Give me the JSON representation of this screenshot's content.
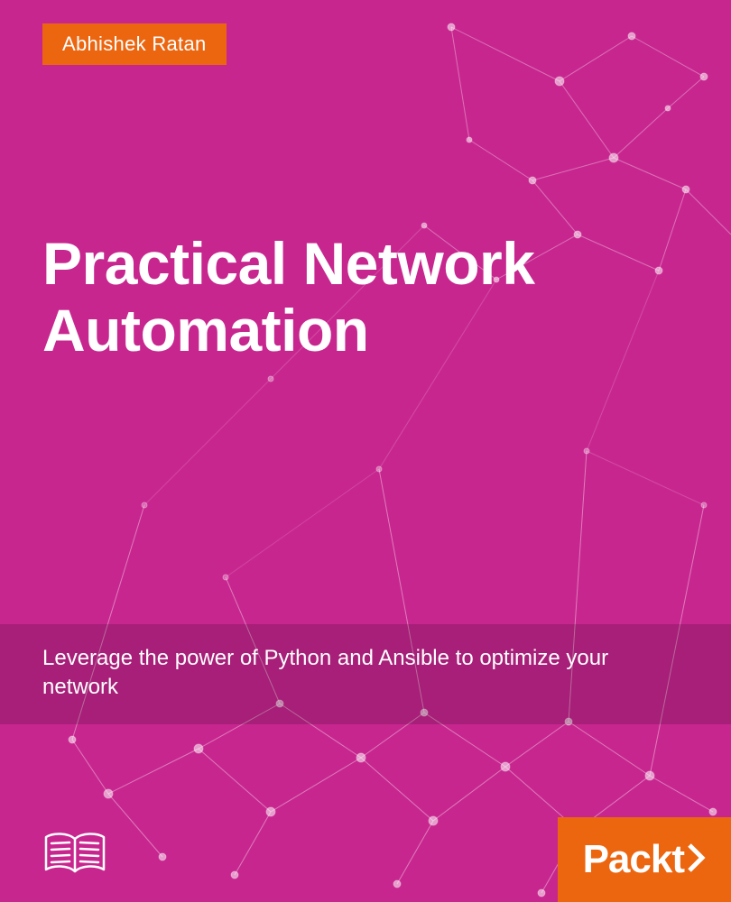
{
  "author": "Abhishek Ratan",
  "title": "Practical Network Automation",
  "subtitle": "Leverage the power of Python and Ansible to optimize your network",
  "publisher": "Packt",
  "colors": {
    "background": "#c8268f",
    "accent": "#ec6610",
    "text": "#ffffff"
  },
  "icons": {
    "book": "book-icon",
    "network_pattern": "network-graph-icon"
  }
}
